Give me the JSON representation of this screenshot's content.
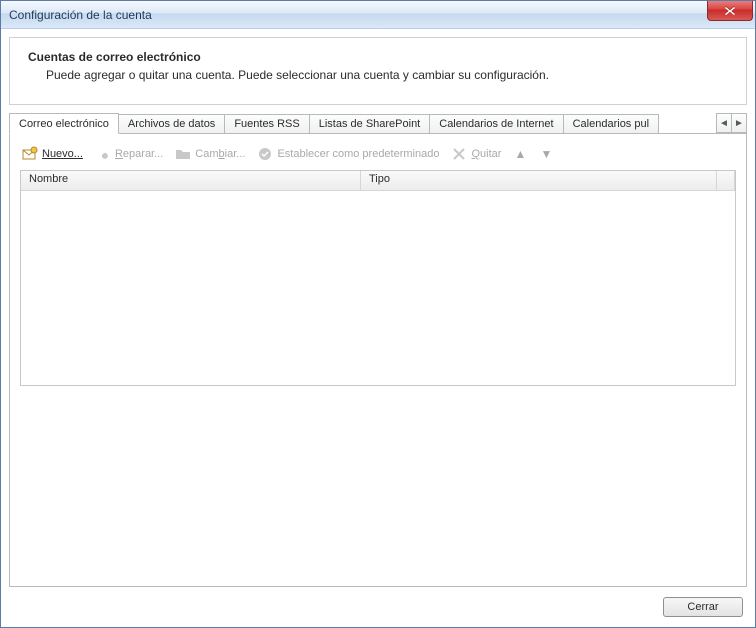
{
  "window": {
    "title": "Configuración de la cuenta"
  },
  "header": {
    "title": "Cuentas de correo electrónico",
    "description": "Puede agregar o quitar una cuenta. Puede seleccionar una cuenta y cambiar su configuración."
  },
  "tabs": [
    {
      "label": "Correo electrónico",
      "active": true
    },
    {
      "label": "Archivos de datos",
      "active": false
    },
    {
      "label": "Fuentes RSS",
      "active": false
    },
    {
      "label": "Listas de SharePoint",
      "active": false
    },
    {
      "label": "Calendarios de Internet",
      "active": false
    },
    {
      "label": "Calendarios pul",
      "active": false
    }
  ],
  "toolbar": {
    "new": "Nuevo...",
    "repair": "Reparar...",
    "change": "Cambiar...",
    "setdefault": "Establecer como predeterminado",
    "remove": "Quitar"
  },
  "columns": {
    "name": "Nombre",
    "type": "Tipo"
  },
  "rows": [],
  "footer": {
    "close": "Cerrar"
  }
}
